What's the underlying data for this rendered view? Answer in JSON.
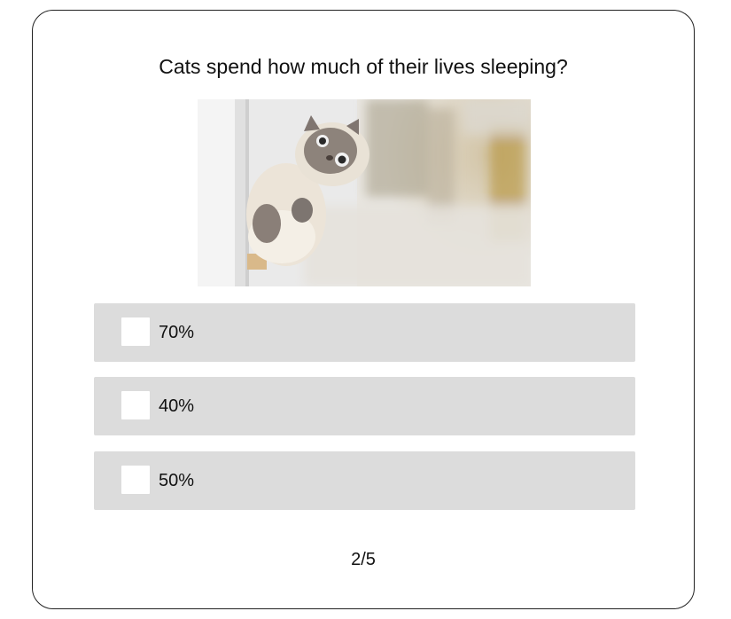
{
  "quiz": {
    "question": "Cats spend how much of their lives sleeping?",
    "image": {
      "subject": "cat-photo"
    },
    "options": [
      {
        "label": "70%"
      },
      {
        "label": "40%"
      },
      {
        "label": "50%"
      }
    ],
    "progress": "2/5"
  }
}
